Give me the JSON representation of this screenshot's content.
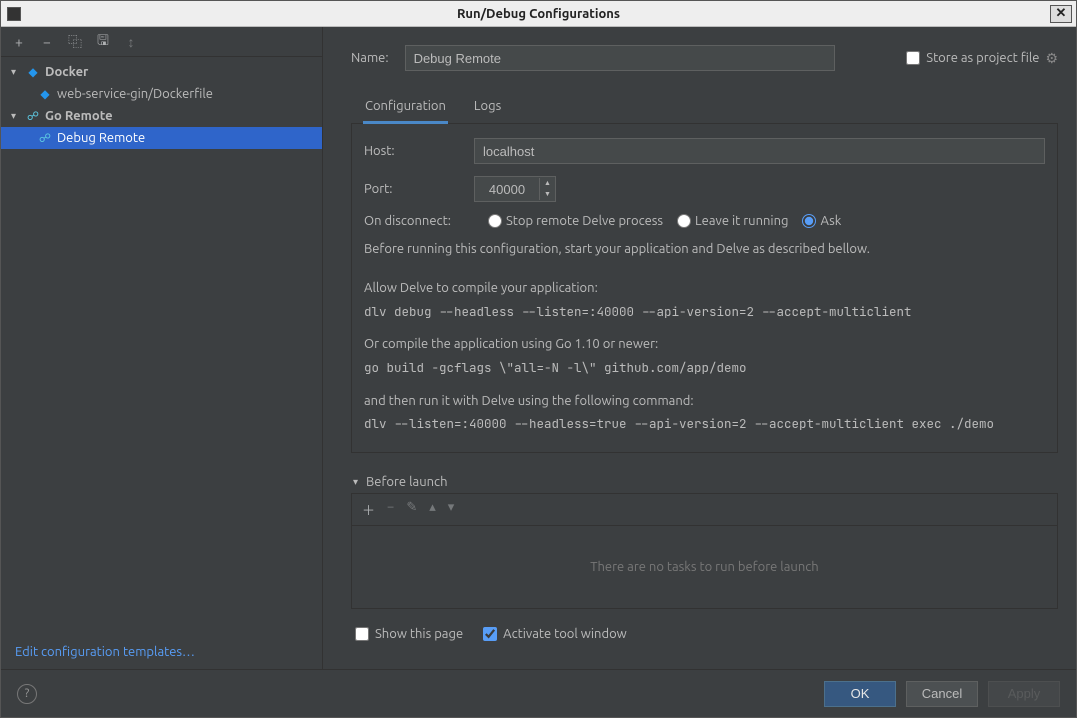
{
  "window": {
    "title": "Run/Debug Configurations",
    "close_tooltip": "Close"
  },
  "toolbar": {
    "add": "+",
    "remove": "−",
    "copy": "⿻",
    "save": "🖫",
    "sort": "↕"
  },
  "tree": {
    "docker": {
      "label": "Docker"
    },
    "docker_item": {
      "label": "web-service-gin/Dockerfile"
    },
    "go_remote": {
      "label": "Go Remote"
    },
    "go_remote_item": {
      "label": "Debug Remote"
    }
  },
  "edit_templates": "Edit configuration templates…",
  "form": {
    "name_label": "Name:",
    "name_value": "Debug Remote",
    "store_label": "Store as project file"
  },
  "tabs": {
    "configuration": "Configuration",
    "logs": "Logs"
  },
  "config": {
    "host_label": "Host:",
    "host_value": "localhost",
    "port_label": "Port:",
    "port_value": "40000",
    "disconnect_label": "On disconnect:",
    "opt_stop": "Stop remote Delve process",
    "opt_leave": "Leave it running",
    "opt_ask": "Ask",
    "help1": "Before running this configuration, start your application and Delve as described bellow.",
    "help2": "Allow Delve to compile your application:",
    "cmd1": "dlv debug --headless --listen=:40000 --api-version=2 --accept-multiclient",
    "help3": "Or compile the application using Go 1.10 or newer:",
    "cmd2": "go build -gcflags \\\"all=-N -l\\\" github.com/app/demo",
    "help4": "and then run it with Delve using the following command:",
    "cmd3": "dlv --listen=:40000 --headless=true --api-version=2 --accept-multiclient exec ./demo"
  },
  "before_launch": {
    "title": "Before launch",
    "empty": "There are no tasks to run before launch"
  },
  "checks": {
    "show_page": "Show this page",
    "activate": "Activate tool window"
  },
  "footer": {
    "ok": "OK",
    "cancel": "Cancel",
    "apply": "Apply"
  }
}
